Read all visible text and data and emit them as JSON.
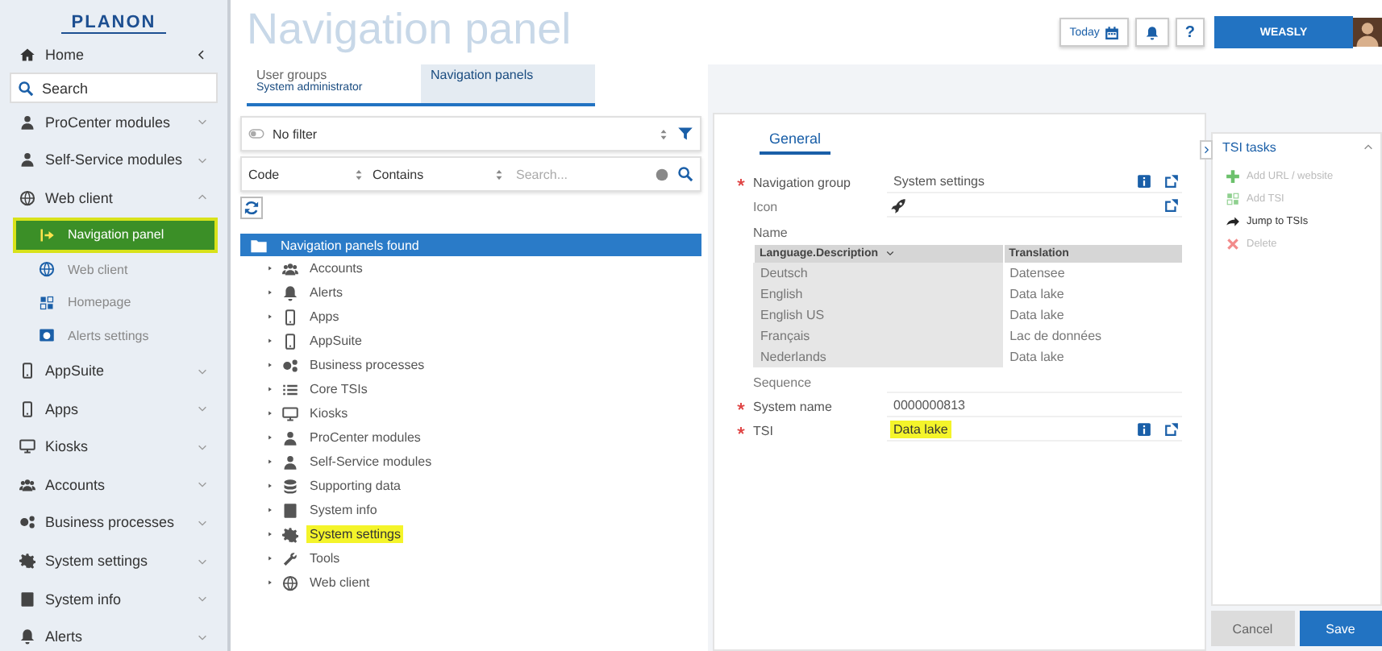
{
  "sidebar": {
    "logo": "PLANON",
    "home": "Home",
    "search": {
      "placeholder": "Search"
    },
    "items": [
      {
        "label": "ProCenter modules",
        "expanded": false
      },
      {
        "label": "Self-Service modules",
        "expanded": false
      },
      {
        "label": "Web client",
        "expanded": true,
        "children": [
          {
            "label": "Navigation panel",
            "selected": true
          },
          {
            "label": "Web client",
            "selected": false
          },
          {
            "label": "Homepage",
            "selected": false
          },
          {
            "label": "Alerts settings",
            "selected": false
          }
        ]
      },
      {
        "label": "AppSuite",
        "expanded": false
      },
      {
        "label": "Apps",
        "expanded": false
      },
      {
        "label": "Kiosks",
        "expanded": false
      },
      {
        "label": "Accounts",
        "expanded": false
      },
      {
        "label": "Business processes",
        "expanded": false
      },
      {
        "label": "System settings",
        "expanded": false
      },
      {
        "label": "System info",
        "expanded": false
      },
      {
        "label": "Alerts",
        "expanded": false
      }
    ]
  },
  "header": {
    "title": "Navigation panel",
    "today": "Today",
    "help": "?",
    "user": "WEASLY"
  },
  "tabs": [
    {
      "label": "User groups",
      "sublabel": "System administrator",
      "selected": false
    },
    {
      "label": "Navigation panels",
      "selected": true
    }
  ],
  "filter": {
    "value": "No filter"
  },
  "search_bar": {
    "field": "Code",
    "operator": "Contains",
    "placeholder": "Search..."
  },
  "tree": {
    "root": {
      "label": "Navigation panels found",
      "selected": true
    },
    "items": [
      {
        "label": "Accounts",
        "highlighted": false
      },
      {
        "label": "Alerts",
        "highlighted": false
      },
      {
        "label": "Apps",
        "highlighted": false
      },
      {
        "label": "AppSuite",
        "highlighted": false
      },
      {
        "label": "Business processes",
        "highlighted": false
      },
      {
        "label": "Core TSIs",
        "highlighted": false
      },
      {
        "label": "Kiosks",
        "highlighted": false
      },
      {
        "label": "ProCenter modules",
        "highlighted": false
      },
      {
        "label": "Self-Service modules",
        "highlighted": false
      },
      {
        "label": "Supporting data",
        "highlighted": false
      },
      {
        "label": "System info",
        "highlighted": false
      },
      {
        "label": "System settings",
        "highlighted": true
      },
      {
        "label": "Tools",
        "highlighted": false
      },
      {
        "label": "Web client",
        "highlighted": false
      }
    ]
  },
  "detail": {
    "tab": "General",
    "fields": [
      {
        "kind": "text",
        "label": "Navigation group",
        "required": true,
        "value": "System settings",
        "highlighted": false,
        "info": true
      },
      {
        "kind": "icon",
        "label": "Icon",
        "required": false
      },
      {
        "kind": "table",
        "label": "Name",
        "columns": [
          "Language.Description",
          "Translation"
        ],
        "rows": [
          [
            "Deutsch",
            "Datensee"
          ],
          [
            "English",
            "Data lake"
          ],
          [
            "English US",
            "Data lake"
          ],
          [
            "Français",
            "Lac de données"
          ],
          [
            "Nederlands",
            "Data lake"
          ]
        ]
      },
      {
        "kind": "text",
        "label": "Sequence",
        "required": false,
        "info": false
      },
      {
        "kind": "text",
        "label": "System name",
        "required": true,
        "value": "0000000813",
        "highlighted": false,
        "info": false
      },
      {
        "kind": "text",
        "label": "TSI",
        "required": true,
        "value": "Data lake",
        "highlighted": true,
        "info": true
      }
    ]
  },
  "tasks": {
    "title": "TSI tasks",
    "items": [
      {
        "label": "Add URL / website",
        "disabled": true
      },
      {
        "label": "Add TSI",
        "disabled": true
      },
      {
        "label": "Jump to TSIs",
        "disabled": false
      },
      {
        "label": "Delete",
        "disabled": true
      }
    ]
  },
  "buttons": {
    "cancel": "Cancel",
    "save": "Save"
  }
}
